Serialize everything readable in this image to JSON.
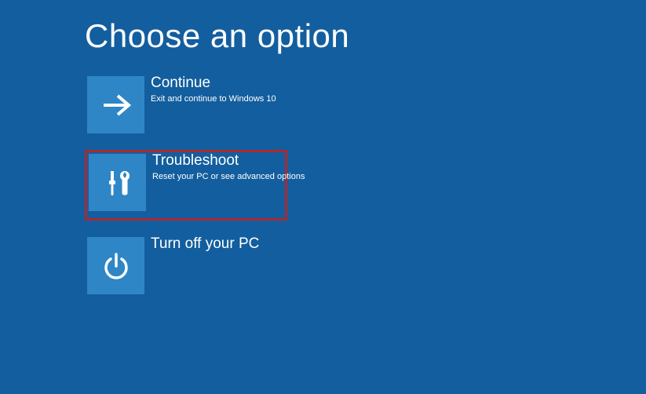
{
  "page": {
    "title": "Choose an option"
  },
  "options": [
    {
      "title": "Continue",
      "desc": "Exit and continue to Windows 10",
      "icon": "arrow-right-icon",
      "highlighted": false
    },
    {
      "title": "Troubleshoot",
      "desc": "Reset your PC or see advanced options",
      "icon": "tools-icon",
      "highlighted": true
    },
    {
      "title": "Turn off your PC",
      "desc": "",
      "icon": "power-icon",
      "highlighted": false
    }
  ],
  "colors": {
    "background": "#135e9e",
    "tile": "#2e86c6",
    "highlight_border": "#aa2a2f"
  }
}
